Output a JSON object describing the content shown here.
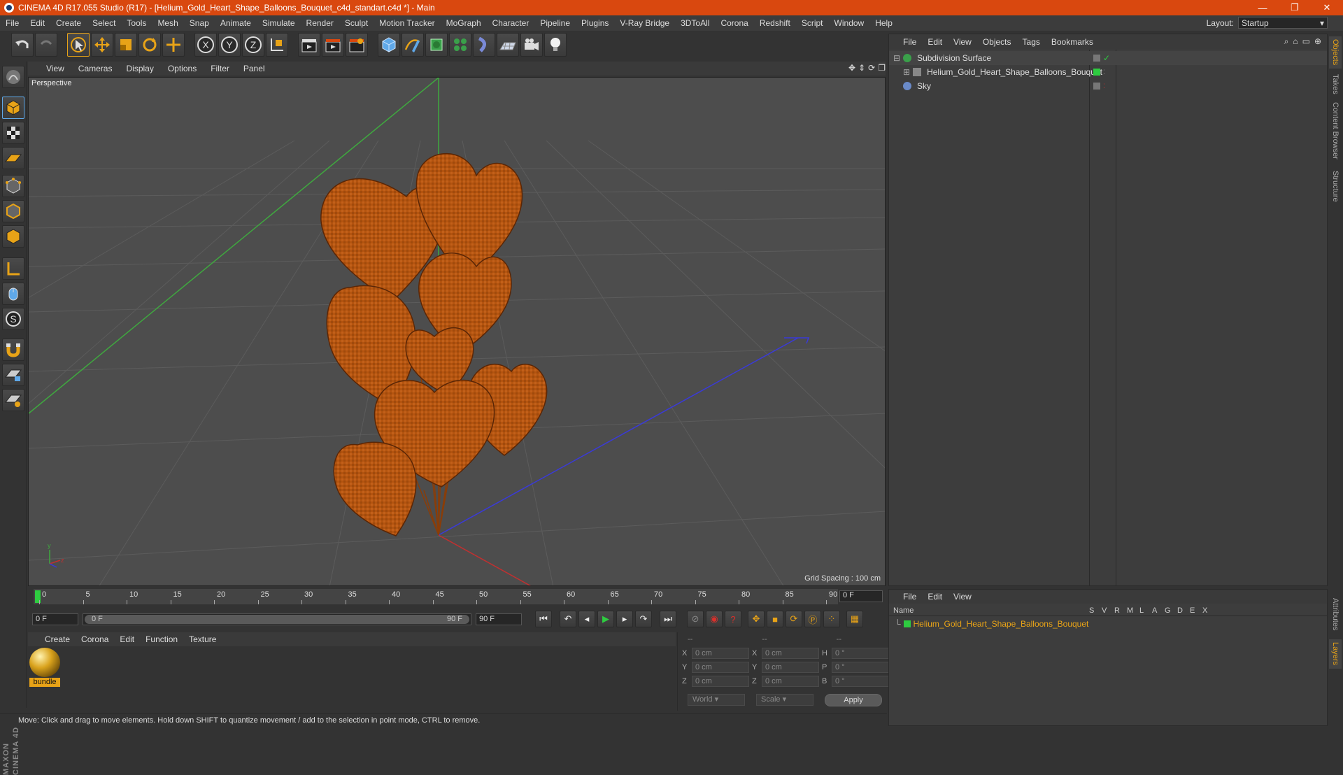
{
  "window": {
    "title": "CINEMA 4D R17.055 Studio (R17) - [Helium_Gold_Heart_Shape_Balloons_Bouquet_c4d_standart.c4d *] - Main",
    "minimize": "—",
    "restore": "❐",
    "close": "✕"
  },
  "menubar": [
    "File",
    "Edit",
    "Create",
    "Select",
    "Tools",
    "Mesh",
    "Snap",
    "Animate",
    "Simulate",
    "Render",
    "Sculpt",
    "Motion Tracker",
    "MoGraph",
    "Character",
    "Pipeline",
    "Plugins",
    "V-Ray Bridge",
    "3DToAll",
    "Corona",
    "Redshift",
    "Script",
    "Window",
    "Help"
  ],
  "layout": {
    "label": "Layout:",
    "value": "Startup"
  },
  "viewport": {
    "menu": [
      "View",
      "Cameras",
      "Display",
      "Options",
      "Filter",
      "Panel"
    ],
    "label": "Perspective",
    "grid_spacing": "Grid Spacing : 100 cm"
  },
  "timeline": {
    "ticks": [
      "0",
      "5",
      "10",
      "15",
      "20",
      "25",
      "30",
      "35",
      "40",
      "45",
      "50",
      "55",
      "60",
      "65",
      "70",
      "75",
      "80",
      "85",
      "90"
    ],
    "current_frame": "0 F",
    "start": "0 F",
    "slider_start": "0 F",
    "slider_end": "90 F",
    "end": "90 F"
  },
  "material_menu": [
    "Create",
    "Corona",
    "Edit",
    "Function",
    "Texture"
  ],
  "material": {
    "name": "bundle"
  },
  "coords": {
    "header": [
      "--",
      "--",
      "--"
    ],
    "rows": [
      {
        "a": "X",
        "av": "0 cm",
        "b": "X",
        "bv": "0 cm",
        "c": "H",
        "cv": "0 °"
      },
      {
        "a": "Y",
        "av": "0 cm",
        "b": "Y",
        "bv": "0 cm",
        "c": "P",
        "cv": "0 °"
      },
      {
        "a": "Z",
        "av": "0 cm",
        "b": "Z",
        "bv": "0 cm",
        "c": "B",
        "cv": "0 °"
      }
    ],
    "world": "World",
    "scale": "Scale",
    "apply": "Apply"
  },
  "status": "Move: Click and drag to move elements. Hold down SHIFT to quantize movement / add to the selection in point mode, CTRL to remove.",
  "object_manager": {
    "menu": [
      "File",
      "Edit",
      "View",
      "Objects",
      "Tags",
      "Bookmarks"
    ],
    "objects": [
      {
        "name": "Subdivision Surface",
        "color": "#3aa04a"
      },
      {
        "name": "Helium_Gold_Heart_Shape_Balloons_Bouquet",
        "color": "#888888"
      },
      {
        "name": "Sky",
        "color": "#6a8ac8"
      }
    ]
  },
  "side_tabs": [
    "Objects",
    "Takes",
    "Content Browser",
    "Structure",
    "Attributes",
    "Layers"
  ],
  "layer_manager": {
    "menu": [
      "File",
      "Edit",
      "View"
    ],
    "columns": [
      "Name",
      "S",
      "V",
      "R",
      "M",
      "L",
      "A",
      "G",
      "D",
      "E",
      "X"
    ],
    "row": "Helium_Gold_Heart_Shape_Balloons_Bouquet"
  },
  "maxon": "MAXON CINEMA 4D",
  "colors": {
    "titlebar": "#d9480f",
    "accent": "#e8a317",
    "balloon": "#b4540f"
  }
}
